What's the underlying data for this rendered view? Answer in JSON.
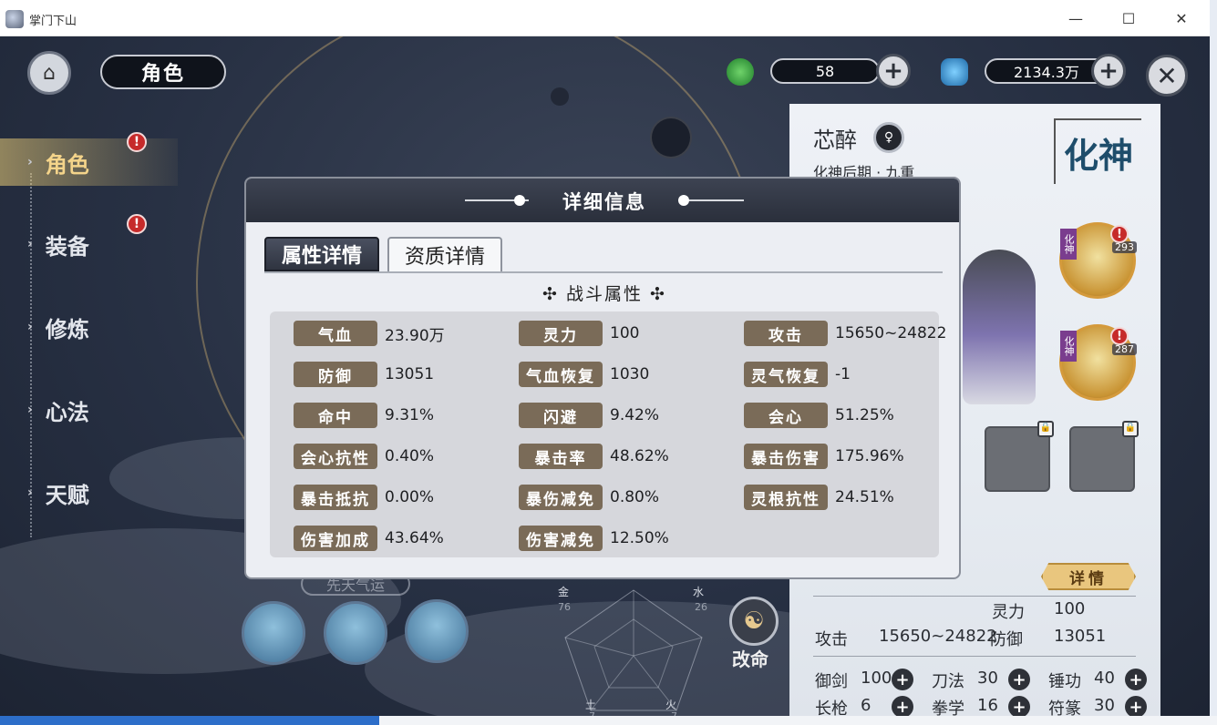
{
  "window": {
    "title": "掌门下山",
    "min": "—",
    "max": "☐",
    "close": "✕"
  },
  "hud": {
    "page_title": "角色",
    "resource1_value": "58",
    "resource2_value": "2134.3万",
    "plus": "+",
    "close": "✕"
  },
  "nav": {
    "items": [
      {
        "label": "角色",
        "alert": "!"
      },
      {
        "label": "装备",
        "alert": "!"
      },
      {
        "label": "修炼"
      },
      {
        "label": "心法"
      },
      {
        "label": "天赋"
      }
    ],
    "arrow": "›"
  },
  "bottom": {
    "qifa_label": "先天气运",
    "radar": {
      "labels": [
        "金",
        "水",
        "火",
        "土"
      ],
      "values": [
        "76",
        "26",
        "7",
        "7"
      ]
    },
    "gaiming_label": "改命"
  },
  "panel": {
    "name": "芯醉",
    "realm_sub": "化神后期 · 九重",
    "realm_big": "化神",
    "equip": [
      {
        "tag": "化神",
        "level": "293",
        "alert": "!"
      },
      {
        "tag": "化神",
        "level": "287",
        "alert": "!"
      }
    ],
    "detail_button": "详情",
    "lingli_label": "灵力",
    "lingli_value": "100",
    "gongji_label": "攻击",
    "gongji_value": "15650~24822",
    "fangyu_label": "防御",
    "fangyu_value": "13051",
    "skills": [
      {
        "label": "御剑",
        "value": "100"
      },
      {
        "label": "刀法",
        "value": "30"
      },
      {
        "label": "锤功",
        "value": "40"
      },
      {
        "label": "长枪",
        "value": "6"
      },
      {
        "label": "拳学",
        "value": "16"
      },
      {
        "label": "符篆",
        "value": "30"
      }
    ]
  },
  "modal": {
    "title": "详细信息",
    "tabs": [
      "属性详情",
      "资质详情"
    ],
    "section_title": "✣ 战斗属性 ✣",
    "stats": [
      {
        "label": "气血",
        "value": "23.90万"
      },
      {
        "label": "灵力",
        "value": "100"
      },
      {
        "label": "攻击",
        "value": "15650~24822"
      },
      {
        "label": "防御",
        "value": "13051"
      },
      {
        "label": "气血恢复",
        "value": "1030"
      },
      {
        "label": "灵气恢复",
        "value": "-1"
      },
      {
        "label": "命中",
        "value": "9.31%"
      },
      {
        "label": "闪避",
        "value": "9.42%"
      },
      {
        "label": "会心",
        "value": "51.25%"
      },
      {
        "label": "会心抗性",
        "value": "0.40%"
      },
      {
        "label": "暴击率",
        "value": "48.62%"
      },
      {
        "label": "暴击伤害",
        "value": "175.96%"
      },
      {
        "label": "暴击抵抗",
        "value": "0.00%"
      },
      {
        "label": "暴伤减免",
        "value": "0.80%"
      },
      {
        "label": "灵根抗性",
        "value": "24.51%"
      },
      {
        "label": "伤害加成",
        "value": "43.64%"
      },
      {
        "label": "伤害减免",
        "value": "12.50%"
      }
    ]
  }
}
